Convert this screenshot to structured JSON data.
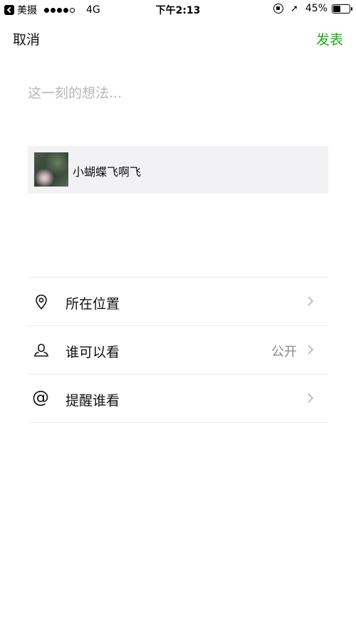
{
  "status_bar": {
    "back_app": "美摄",
    "carrier": "4G",
    "time": "下午2:13",
    "battery": "45%",
    "battery_level": 0.45
  },
  "nav": {
    "cancel_label": "取消",
    "publish_label": "发表"
  },
  "composer": {
    "placeholder": "这一刻的想法...",
    "value": ""
  },
  "share_card": {
    "title": "小蝴蝶飞啊飞"
  },
  "options": [
    {
      "label": "所在位置",
      "value": "",
      "icon": "location-pin-icon"
    },
    {
      "label": "谁可以看",
      "value": "公开",
      "icon": "person-icon"
    },
    {
      "label": "提醒谁看",
      "value": "",
      "icon": "at-sign-icon"
    }
  ],
  "colors": {
    "accent": "#1aad19",
    "placeholder": "#b7b7b7",
    "card_bg": "#f2f2f5"
  }
}
